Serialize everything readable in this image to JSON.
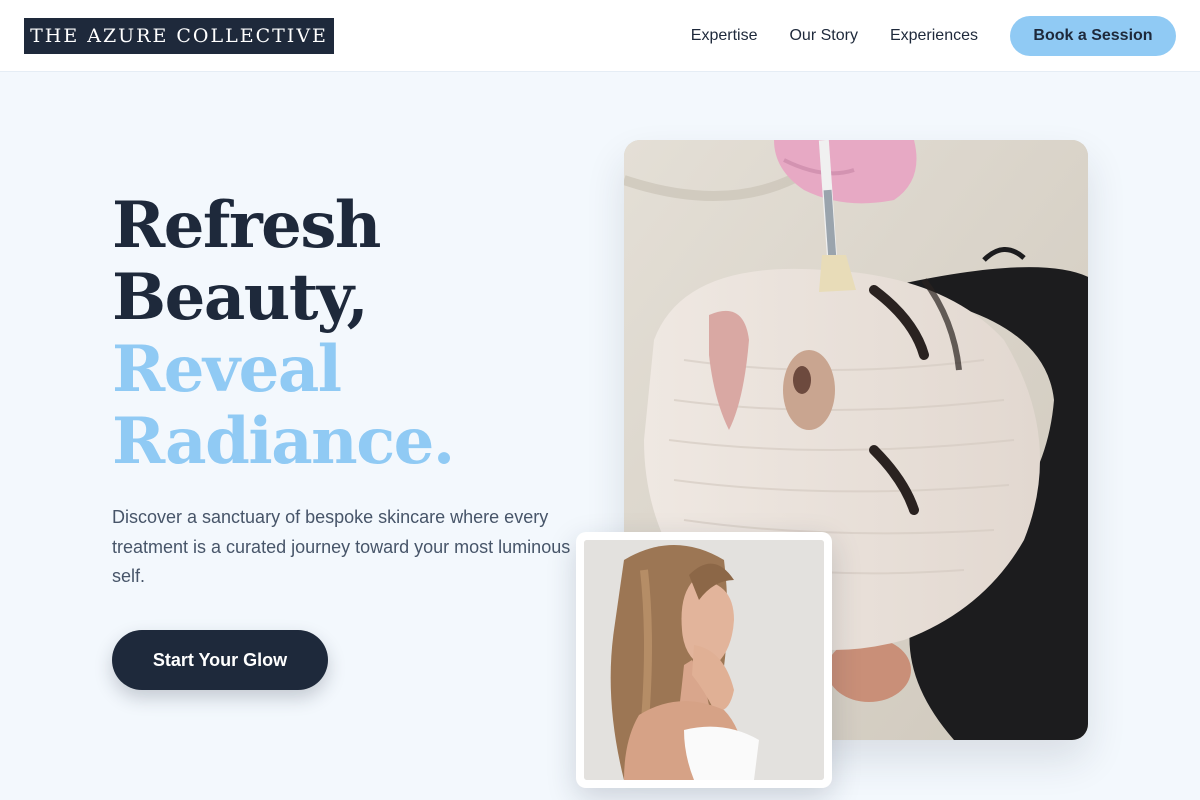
{
  "header": {
    "logo": "THE AZURE COLLECTIVE",
    "nav": [
      "Expertise",
      "Our Story",
      "Experiences"
    ],
    "cta_label": "Book a Session"
  },
  "hero": {
    "headline_dark": [
      "Refresh",
      "Beauty,"
    ],
    "headline_light": [
      "Reveal",
      "Radiance."
    ],
    "description": "Discover a sanctuary of bespoke skincare where every treatment is a curated journey toward your most luminous self.",
    "cta_label": "Start Your Glow"
  },
  "images": {
    "main": "facial-treatment-photo",
    "inset": "woman-portrait-photo"
  },
  "colors": {
    "navy": "#1e293b",
    "accent_blue": "#90caf4",
    "background": "#f3f8fd",
    "body_text": "#475569"
  }
}
